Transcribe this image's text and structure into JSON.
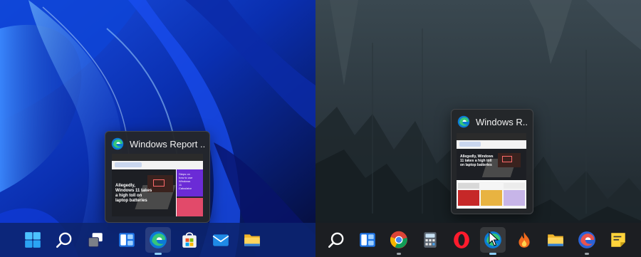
{
  "left_panel": {
    "thumbnail": {
      "app_icon": "edge-icon",
      "title": "Windows Report ...",
      "preview": {
        "hero_text": "Allegedly, Windows 11 takes a high toll on laptop batteries",
        "side_text": "Steps on how to use Windows 11 Calculator"
      }
    },
    "taskbar_icons": [
      {
        "name": "start-icon"
      },
      {
        "name": "search-icon"
      },
      {
        "name": "task-view-icon"
      },
      {
        "name": "widgets-icon"
      },
      {
        "name": "edge-icon",
        "active": true
      },
      {
        "name": "microsoft-store-icon"
      },
      {
        "name": "mail-icon"
      },
      {
        "name": "file-explorer-icon"
      }
    ]
  },
  "right_panel": {
    "thumbnail": {
      "app_icon": "edge-icon",
      "title": "Windows R...",
      "preview": {
        "hero_text": "Allegedly, Windows 11 takes a high toll on laptop batteries"
      }
    },
    "taskbar_icons": [
      {
        "name": "search-icon"
      },
      {
        "name": "widgets-icon"
      },
      {
        "name": "chrome-icon"
      },
      {
        "name": "calculator-icon"
      },
      {
        "name": "opera-icon"
      },
      {
        "name": "edge-icon",
        "active": true
      },
      {
        "name": "app-flame-icon"
      },
      {
        "name": "file-explorer-icon"
      },
      {
        "name": "edge-beta-icon"
      },
      {
        "name": "sticky-notes-icon"
      }
    ]
  },
  "colors": {
    "left_taskbar": "#0c246e",
    "right_taskbar": "#1c1e22",
    "accent_indicator": "#8ecdf7"
  }
}
